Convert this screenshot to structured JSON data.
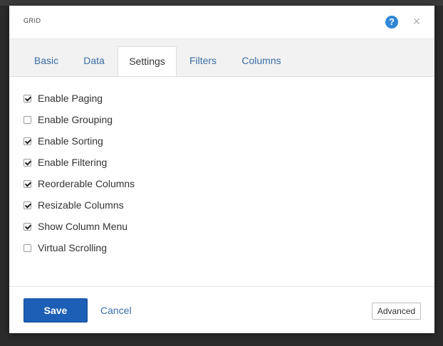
{
  "dialog": {
    "title": "GRID",
    "help_icon": "question-circle-icon",
    "help_glyph": "?",
    "close_icon": "close-icon",
    "close_glyph": "×"
  },
  "tabs": [
    {
      "label": "Basic",
      "active": false
    },
    {
      "label": "Data",
      "active": false
    },
    {
      "label": "Settings",
      "active": true
    },
    {
      "label": "Filters",
      "active": false
    },
    {
      "label": "Columns",
      "active": false
    }
  ],
  "settings": {
    "options": [
      {
        "label": "Enable Paging",
        "checked": true
      },
      {
        "label": "Enable Grouping",
        "checked": false
      },
      {
        "label": "Enable Sorting",
        "checked": true
      },
      {
        "label": "Enable Filtering",
        "checked": true
      },
      {
        "label": "Reorderable Columns",
        "checked": true
      },
      {
        "label": "Resizable Columns",
        "checked": true
      },
      {
        "label": "Show Column Menu",
        "checked": true
      },
      {
        "label": "Virtual Scrolling",
        "checked": false
      }
    ]
  },
  "footer": {
    "save_label": "Save",
    "cancel_label": "Cancel",
    "advanced_label": "Advanced"
  },
  "colors": {
    "primary": "#1d5fb6",
    "link": "#3a6ea5",
    "help": "#2f86d6"
  }
}
